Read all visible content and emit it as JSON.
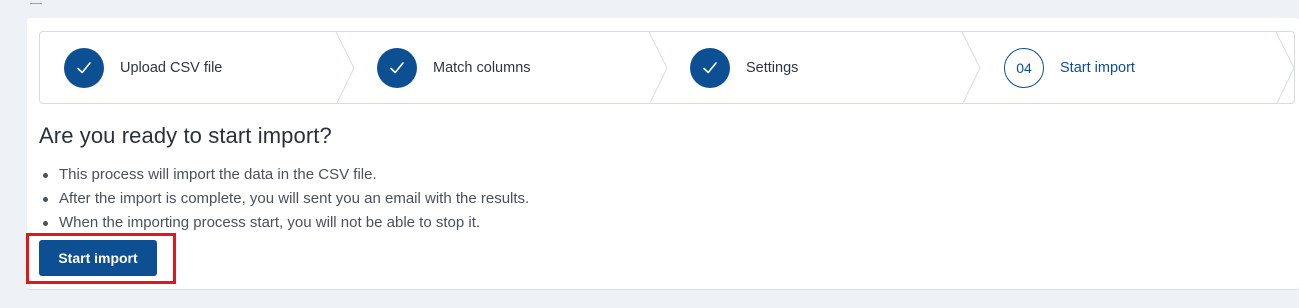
{
  "stepper": {
    "steps": [
      {
        "label": "Upload CSV file",
        "state": "done"
      },
      {
        "label": "Match columns",
        "state": "done"
      },
      {
        "label": "Settings",
        "state": "done"
      },
      {
        "label": "Start import",
        "state": "current",
        "number": "04"
      }
    ]
  },
  "main": {
    "title": "Are you ready to start import?",
    "bullets": [
      "This process will import the data in the CSV file.",
      "After the import is complete, you will sent you an email with the results.",
      "When the importing process start, you will not be able to stop it."
    ],
    "start_button_label": "Start import"
  },
  "colors": {
    "accent": "#0d4f93",
    "highlight": "#e3161c"
  },
  "icons": {
    "done_step": "check-icon"
  }
}
